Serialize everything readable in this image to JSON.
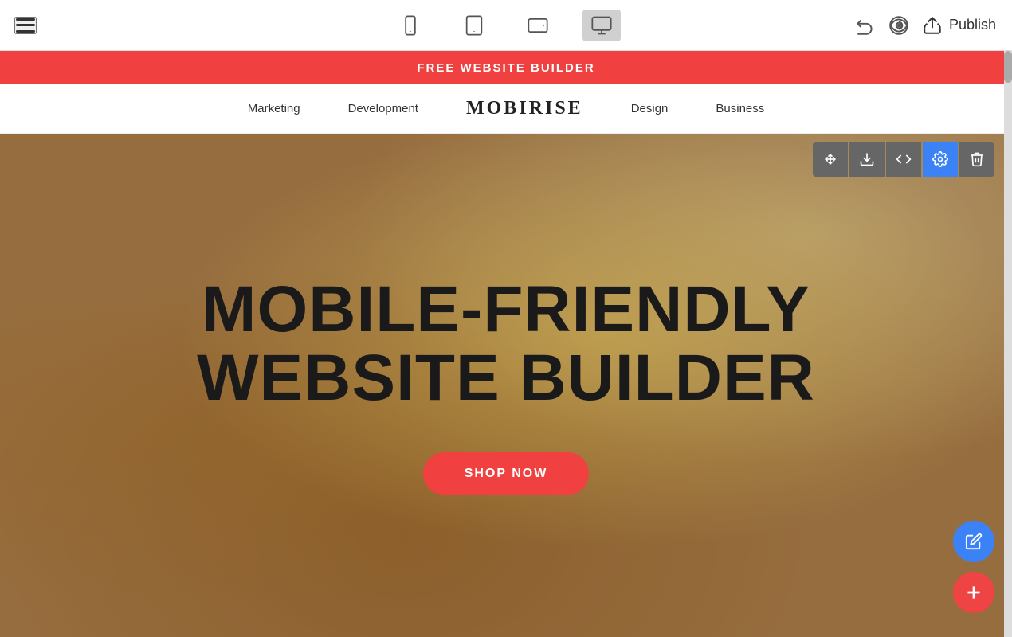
{
  "toolbar": {
    "menu_icon": "hamburger-icon",
    "devices": [
      {
        "id": "mobile",
        "label": "Mobile view",
        "active": false
      },
      {
        "id": "tablet",
        "label": "Tablet view",
        "active": false
      },
      {
        "id": "tablet-landscape",
        "label": "Tablet landscape view",
        "active": false
      },
      {
        "id": "desktop",
        "label": "Desktop view",
        "active": true
      }
    ],
    "undo_label": "Undo",
    "preview_label": "Preview",
    "publish_label": "Publish"
  },
  "banner": {
    "text": "FREE WEBSITE BUILDER"
  },
  "nav": {
    "items": [
      {
        "label": "Marketing"
      },
      {
        "label": "Development"
      },
      {
        "label": "Design"
      },
      {
        "label": "Business"
      }
    ],
    "logo": "MOBIRISE"
  },
  "hero": {
    "title_line1": "MOBILE-FRIENDLY",
    "title_line2": "WEBSITE BUILDER",
    "cta_label": "SHOP NOW"
  },
  "block_controls": [
    {
      "id": "move",
      "label": "Move block",
      "active": false
    },
    {
      "id": "download",
      "label": "Download block",
      "active": false
    },
    {
      "id": "code",
      "label": "Edit code",
      "active": false
    },
    {
      "id": "settings",
      "label": "Block settings",
      "active": true
    },
    {
      "id": "delete",
      "label": "Delete block",
      "active": false
    }
  ],
  "fab": {
    "edit_label": "Edit",
    "add_label": "Add block"
  }
}
